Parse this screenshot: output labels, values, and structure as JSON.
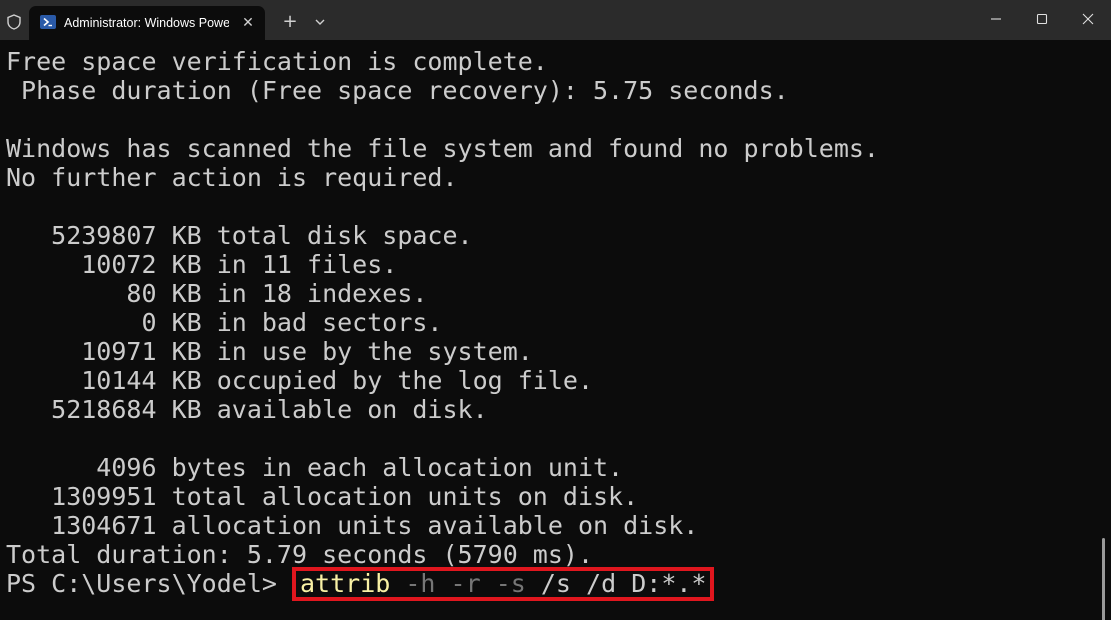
{
  "window": {
    "tab_title": "Administrator: Windows PowerShell",
    "tab_close_glyph": "✕",
    "new_tab_glyph": "+",
    "colors": {
      "titlebar": "#2b2b2b",
      "background": "#0c0c0c",
      "text": "#cccccc",
      "command": "#f9f1a5",
      "parameter": "#767676",
      "highlight_box": "#e0161e"
    }
  },
  "terminal": {
    "lines": [
      "Free space verification is complete.",
      " Phase duration (Free space recovery): 5.75 seconds.",
      "",
      "Windows has scanned the file system and found no problems.",
      "No further action is required.",
      "",
      "   5239807 KB total disk space.",
      "     10072 KB in 11 files.",
      "        80 KB in 18 indexes.",
      "         0 KB in bad sectors.",
      "     10971 KB in use by the system.",
      "     10144 KB occupied by the log file.",
      "   5218684 KB available on disk.",
      "",
      "      4096 bytes in each allocation unit.",
      "   1309951 total allocation units on disk.",
      "   1304671 allocation units available on disk.",
      "Total duration: 5.79 seconds (5790 ms)."
    ],
    "prompt": "PS C:\\Users\\Yodel> ",
    "command": {
      "name": "attrib",
      "params": [
        "-h",
        "-r",
        "-s",
        "/s",
        "/d"
      ],
      "target": "D:*.*"
    }
  }
}
